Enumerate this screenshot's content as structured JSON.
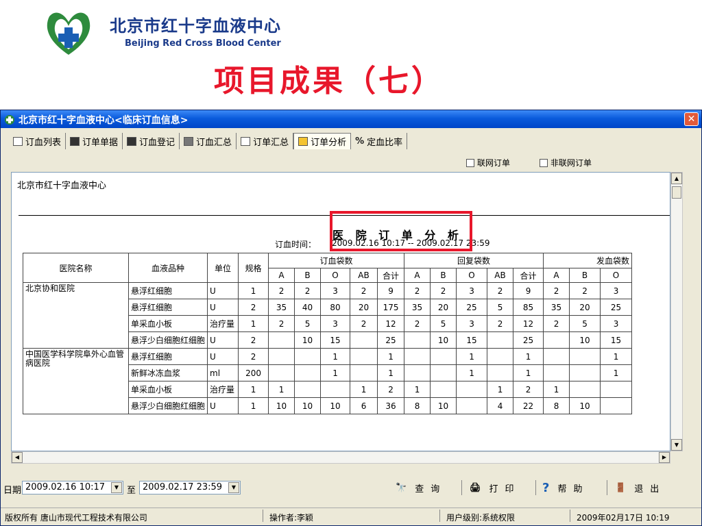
{
  "slide": {
    "org_cn": "北京市红十字血液中心",
    "org_en": "Beijing Red Cross Blood Center",
    "title": "项目成果（七）"
  },
  "window": {
    "title": "北京市红十字血液中心<临床订血信息>",
    "close_label": "✕"
  },
  "tabs": [
    {
      "label": "订血列表",
      "icon": "clock-list-icon"
    },
    {
      "label": "订单单据",
      "icon": "grid-icon"
    },
    {
      "label": "订血登记",
      "icon": "table-icon"
    },
    {
      "label": "订血汇总",
      "icon": "sum-icon"
    },
    {
      "label": "订单汇总",
      "icon": "columns-icon"
    },
    {
      "label": "订单分析",
      "icon": "analysis-icon"
    },
    {
      "label": "定血比率",
      "icon": "percent-icon",
      "glyph": "%"
    }
  ],
  "options": {
    "networked": "联网订单",
    "non_networked": "非联网订单"
  },
  "report": {
    "org": "北京市红十字血液中心",
    "title": "医 院 订 单 分 析",
    "time_label": "订血时间：",
    "time_value": "2009.02.16 10:17 -- 2009.02.17 23:59",
    "headers": {
      "hospital": "医院名称",
      "product": "血液品种",
      "unit": "单位",
      "spec": "规格",
      "ordered": "订血袋数",
      "replied": "回复袋数",
      "issued": "发血袋数",
      "groups": [
        "A",
        "B",
        "O",
        "AB",
        "合计",
        "A",
        "B",
        "O",
        "AB",
        "合计",
        "A",
        "B",
        "O"
      ]
    },
    "rows": [
      [
        "北京协和医院",
        "悬浮红细胞",
        "U",
        "1",
        "2",
        "2",
        "3",
        "2",
        "9",
        "2",
        "2",
        "3",
        "2",
        "9",
        "2",
        "2",
        "3"
      ],
      [
        "",
        "悬浮红细胞",
        "U",
        "2",
        "35",
        "40",
        "80",
        "20",
        "175",
        "35",
        "20",
        "25",
        "5",
        "85",
        "35",
        "20",
        "25"
      ],
      [
        "",
        "单采血小板",
        "治疗量",
        "1",
        "2",
        "5",
        "3",
        "2",
        "12",
        "2",
        "5",
        "3",
        "2",
        "12",
        "2",
        "5",
        "3"
      ],
      [
        "",
        "悬浮少白细胞红细胞",
        "U",
        "2",
        "",
        "10",
        "15",
        "",
        "25",
        "",
        "10",
        "15",
        "",
        "25",
        "",
        "10",
        "15"
      ],
      [
        "中国医学科学院阜外心血管病医院",
        "悬浮红细胞",
        "U",
        "2",
        "",
        "",
        "1",
        "",
        "1",
        "",
        "",
        "1",
        "",
        "1",
        "",
        "",
        "1"
      ],
      [
        "",
        "新鲜冰冻血浆",
        "ml",
        "200",
        "",
        "",
        "1",
        "",
        "1",
        "",
        "",
        "1",
        "",
        "1",
        "",
        "",
        "1"
      ],
      [
        "",
        "单采血小板",
        "治疗量",
        "1",
        "1",
        "",
        "",
        "1",
        "2",
        "1",
        "",
        "",
        "1",
        "2",
        "1",
        "",
        ""
      ],
      [
        "",
        "悬浮少白细胞红细胞",
        "U",
        "1",
        "10",
        "10",
        "10",
        "6",
        "36",
        "8",
        "10",
        "",
        "4",
        "22",
        "8",
        "10",
        ""
      ]
    ]
  },
  "query": {
    "date_label": "日期",
    "from": "2009.02.16 10:17",
    "to_label": "至",
    "to": "2009.02.17 23:59",
    "search": "查询",
    "print": "打印",
    "help": "帮助",
    "exit": "退出"
  },
  "status": {
    "copyright": "版权所有 唐山市现代工程技术有限公司",
    "operator": "操作者:李颖",
    "level": "用户级别:系统权限",
    "datetime": "2009年02月17日 10:19"
  },
  "colors": {
    "title_red": "#e8172b",
    "brand_blue": "#1a3a8a",
    "titlebar_blue": "#0a5bdc"
  }
}
